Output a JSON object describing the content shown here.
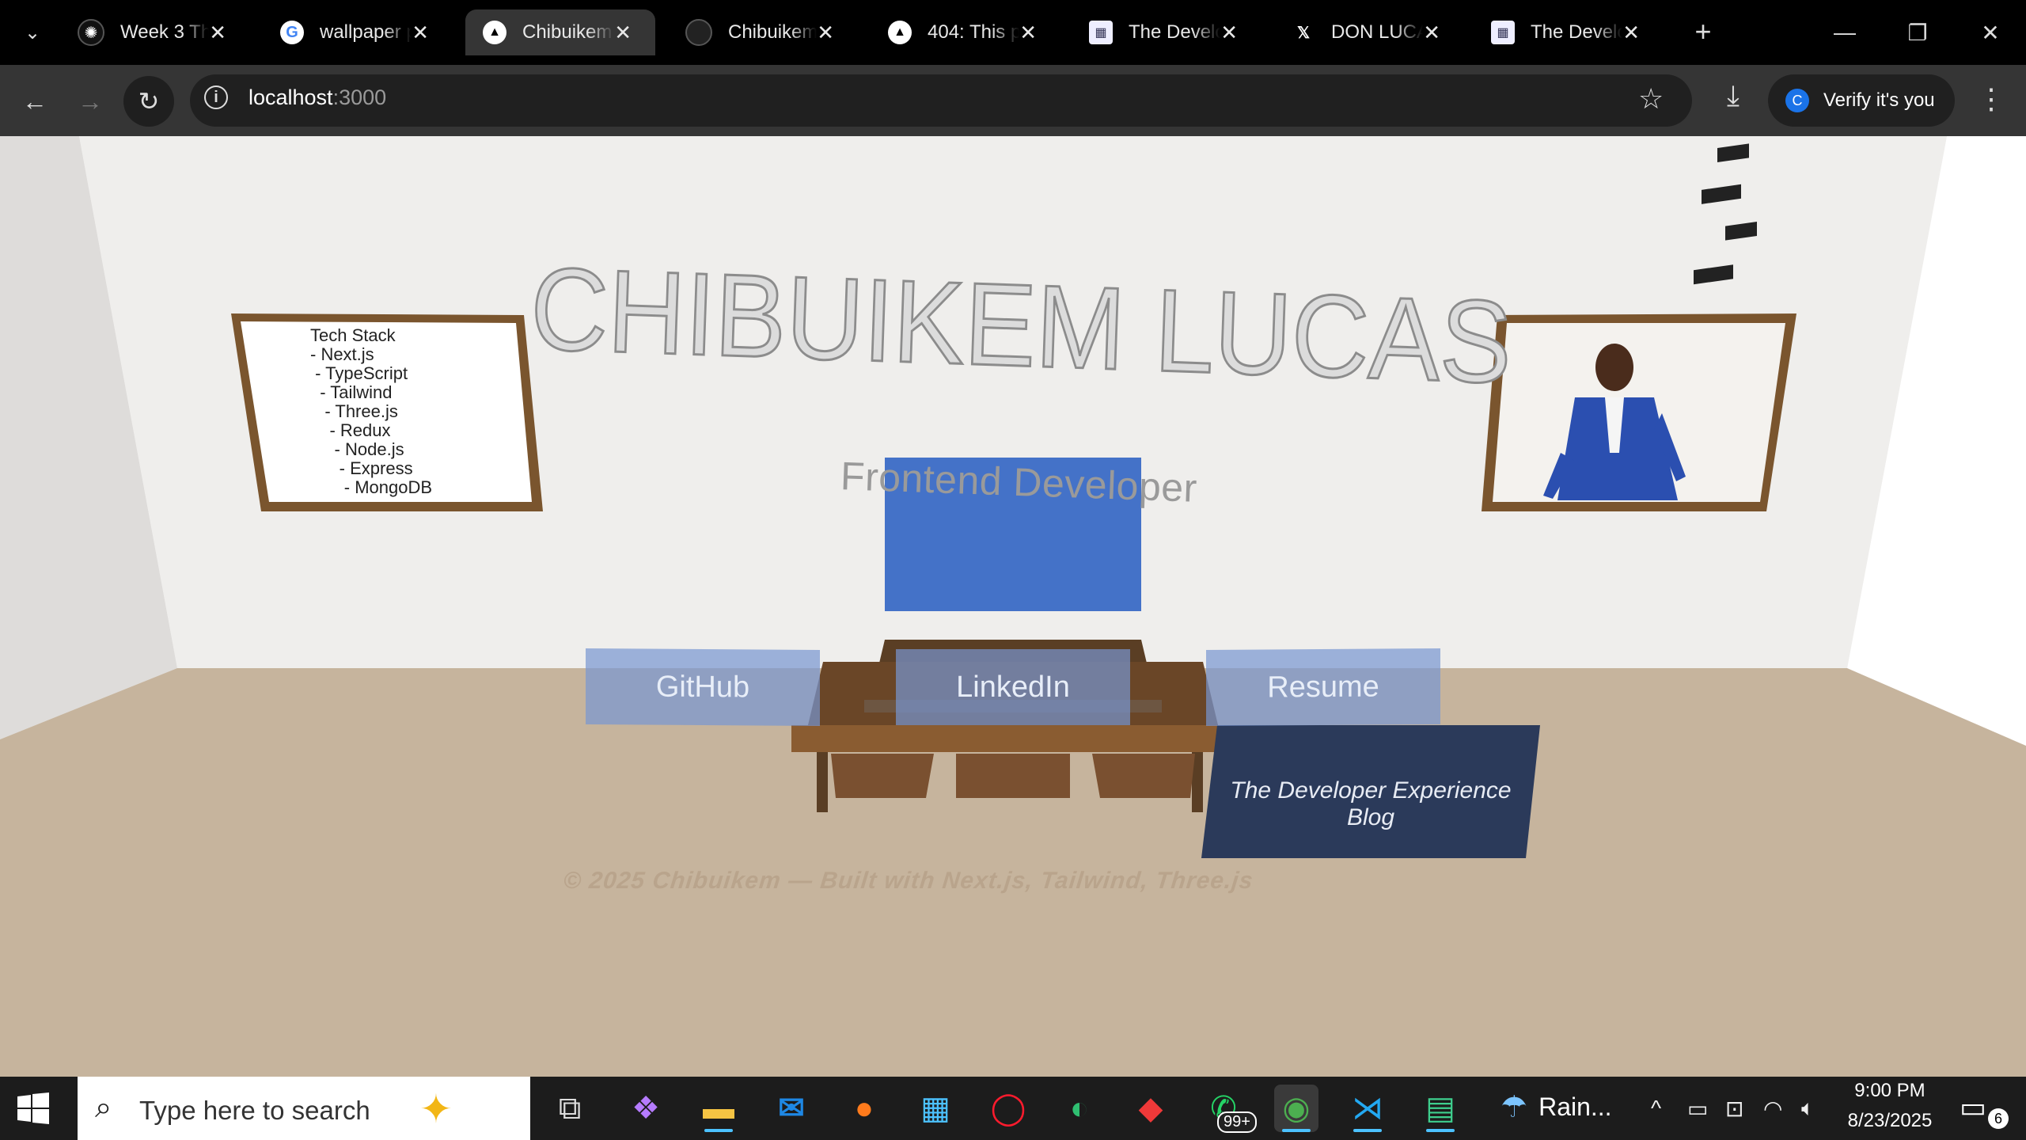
{
  "browser": {
    "tabs": [
      {
        "title": "Week 3 The",
        "icon": "openai-icon",
        "active": false
      },
      {
        "title": "wallpaper p",
        "icon": "google-icon",
        "active": false
      },
      {
        "title": "Chibuikem",
        "icon": "vercel-icon",
        "active": true
      },
      {
        "title": "Chibuikem",
        "icon": "github-icon",
        "active": false
      },
      {
        "title": "404: This p",
        "icon": "vercel-icon",
        "active": false
      },
      {
        "title": "The Develo",
        "icon": "blog-icon",
        "active": false
      },
      {
        "title": "DON LUCA",
        "icon": "x-icon",
        "active": false
      },
      {
        "title": "The Develo",
        "icon": "blog-icon",
        "active": false
      }
    ],
    "url": {
      "host": "localhost",
      "port": ":3000"
    },
    "verify_label": "Verify it's you",
    "profile_initial": "C"
  },
  "page": {
    "name": "CHIBUIKEM LUCAS",
    "tech_stack": "Tech Stack\n- Next.js\n - TypeScript\n  - Tailwind\n   - Three.js\n    - Redux\n     - Node.js\n      - Express\n       - MongoDB",
    "subtitle": "Frontend Developer",
    "buttons": {
      "github": "GitHub",
      "linkedin": "LinkedIn",
      "resume": "Resume"
    },
    "blog_label": "The Developer Experience Blog",
    "footer": "© 2025 Chibuikem — Built with Next.js, Tailwind, Three.js"
  },
  "taskbar": {
    "search_placeholder": "Type here to search",
    "whatsapp_badge": "99+",
    "weather": "Rain...",
    "time": "9:00 PM",
    "date": "8/23/2025",
    "notifications": "6"
  }
}
